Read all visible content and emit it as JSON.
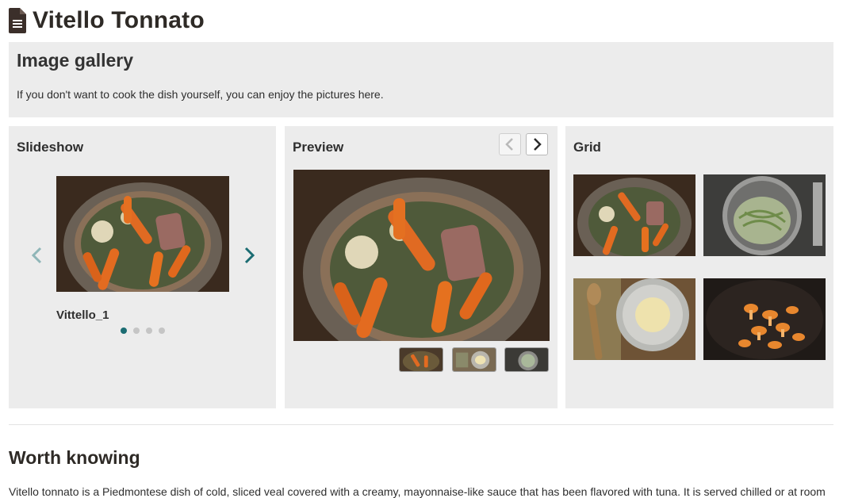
{
  "page": {
    "title": "Vitello Tonnato",
    "icon": "document-icon"
  },
  "gallery": {
    "title": "Image gallery",
    "description": "If you don't want to cook the dish yourself, you can enjoy the pictures here."
  },
  "slideshow": {
    "title": "Slideshow",
    "caption": "Vittello_1",
    "dot_count": 4,
    "active_dot": 1,
    "prev_icon": "chevron-left-icon",
    "next_icon": "chevron-right-icon"
  },
  "preview": {
    "title": "Preview",
    "prev_icon": "chevron-left-icon",
    "next_icon": "chevron-right-icon"
  },
  "grid": {
    "title": "Grid"
  },
  "worth_knowing": {
    "title": "Worth knowing",
    "text": "Vitello tonnato is a Piedmontese dish of cold, sliced veal covered with a creamy, mayonnaise-like sauce that has been flavored with tuna. It is served chilled or at room"
  },
  "colors": {
    "accent": "#1b6c72",
    "panel_bg": "#ececec",
    "text": "#2e2a26"
  }
}
